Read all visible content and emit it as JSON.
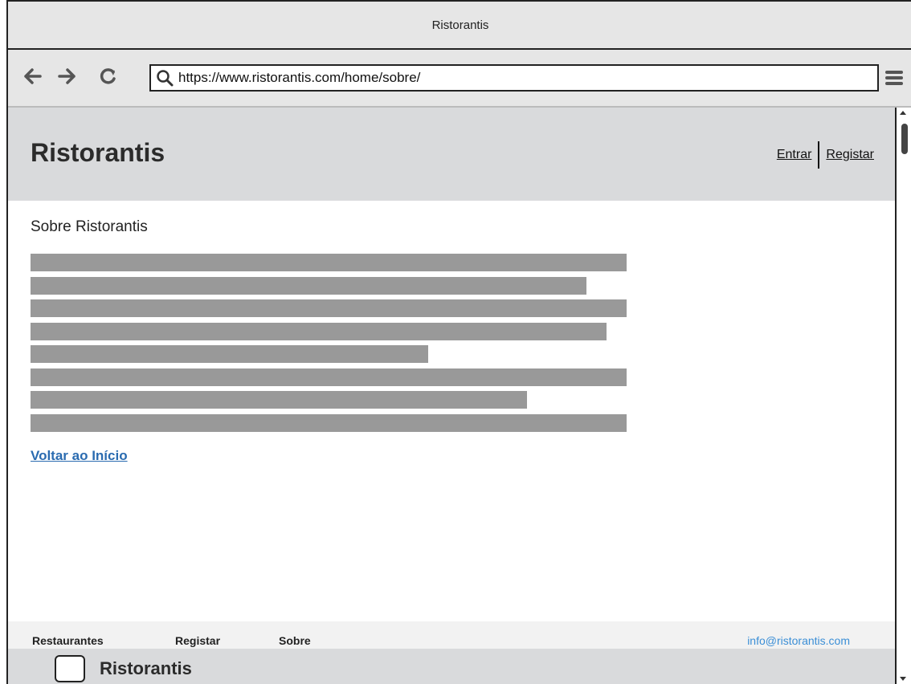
{
  "window": {
    "title": "Ristorantis"
  },
  "browser": {
    "url": "https://www.ristorantis.com/home/sobre/",
    "icons": {
      "back": "arrow-left-icon",
      "forward": "arrow-right-icon",
      "reload": "reload-icon",
      "search": "search-icon",
      "menu": "hamburger-menu-icon"
    }
  },
  "header": {
    "brand": "Ristorantis",
    "login_label": "Entrar",
    "register_label": "Registar"
  },
  "content": {
    "title": "Sobre Ristorantis",
    "text_line_widths_percent": [
      100,
      93.3,
      100,
      96.6,
      66.7,
      100,
      83.3,
      100
    ],
    "back_link": "Voltar ao Início"
  },
  "footer": {
    "links": [
      "Restaurantes",
      "Registar",
      "Sobre"
    ],
    "email": "info@ristorantis.com",
    "brand": "Ristorantis"
  },
  "colors": {
    "header_bg": "#d9dadc",
    "text_placeholder": "#999999",
    "link": "#2a6bb0",
    "email": "#3a8ed6"
  }
}
